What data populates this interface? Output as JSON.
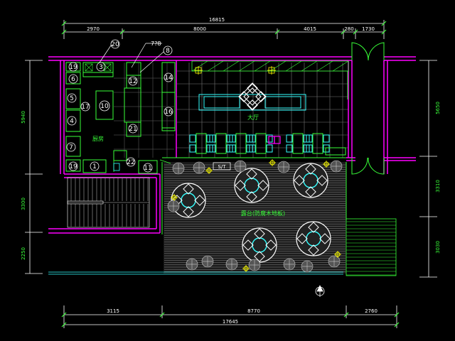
{
  "drawing": {
    "top_dims": {
      "total": "16815",
      "segments": [
        "2970",
        "8000",
        "4015",
        "280",
        "1730"
      ]
    },
    "bottom_dims": {
      "total": "17645",
      "segments": [
        "3115",
        "8770",
        "2760"
      ]
    },
    "left_dims": [
      "5940",
      "3300",
      "2250"
    ],
    "right_dims": [
      "5650",
      "3310",
      "3030"
    ],
    "room_labels": {
      "kitchen": "厨房",
      "hall": "大厅",
      "terrace": "露台(防腐木地板)",
      "service": "S/T"
    },
    "tags": {
      "t1": "1",
      "t3": "3",
      "t4": "4",
      "t5": "5",
      "t6": "6",
      "t7": "7",
      "t8": "8",
      "t10": "10",
      "t11": "11",
      "t12": "12",
      "t14": "14",
      "t16": "16",
      "t17": "17",
      "t19a": "19",
      "t19b": "19",
      "t20": "20",
      "t21": "21",
      "t22": "22",
      "t7b": "7"
    },
    "leader_text": "7?8",
    "colors": {
      "wall": "#ff00ff",
      "wall_alt": "#cc33cc",
      "furniture": "#39ff39",
      "dim": "#ffffff",
      "fixture_cyan": "#33ffff",
      "light": "#ffff00",
      "grid": "#777777",
      "tile": "#8a8a8a"
    }
  }
}
